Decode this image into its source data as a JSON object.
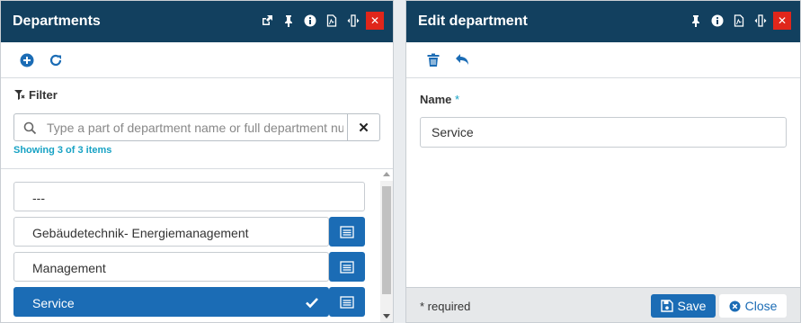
{
  "colors": {
    "titlebar": "#12405f",
    "accent": "#1b6cb5",
    "close": "#e0261b",
    "info": "#17a2c4"
  },
  "left_panel": {
    "title": "Departments",
    "titlebar_icons": [
      "popout-icon",
      "pin-icon",
      "info-icon",
      "pdf-icon",
      "resize-icon",
      "close-icon"
    ],
    "toolbar_icons": [
      "add-icon",
      "refresh-icon"
    ],
    "filter_label": "Filter",
    "search": {
      "placeholder": "Type a part of department name or full department number",
      "value": ""
    },
    "count_text": "Showing 3 of 3 items",
    "items": [
      {
        "label": "---",
        "selected": false
      },
      {
        "label": "Gebäudetechnik- Energiemanagement",
        "selected": false
      },
      {
        "label": "Management",
        "selected": false
      },
      {
        "label": "Service",
        "selected": true
      }
    ]
  },
  "right_panel": {
    "title": "Edit department",
    "titlebar_icons": [
      "pin-icon",
      "info-icon",
      "pdf-icon",
      "resize-icon",
      "close-icon"
    ],
    "toolbar_icons": [
      "delete-icon",
      "undo-icon"
    ],
    "name_label": "Name",
    "required_mark": "*",
    "name_value": "Service",
    "footer": {
      "required_note": "* required",
      "save_label": "Save",
      "close_label": "Close"
    }
  }
}
